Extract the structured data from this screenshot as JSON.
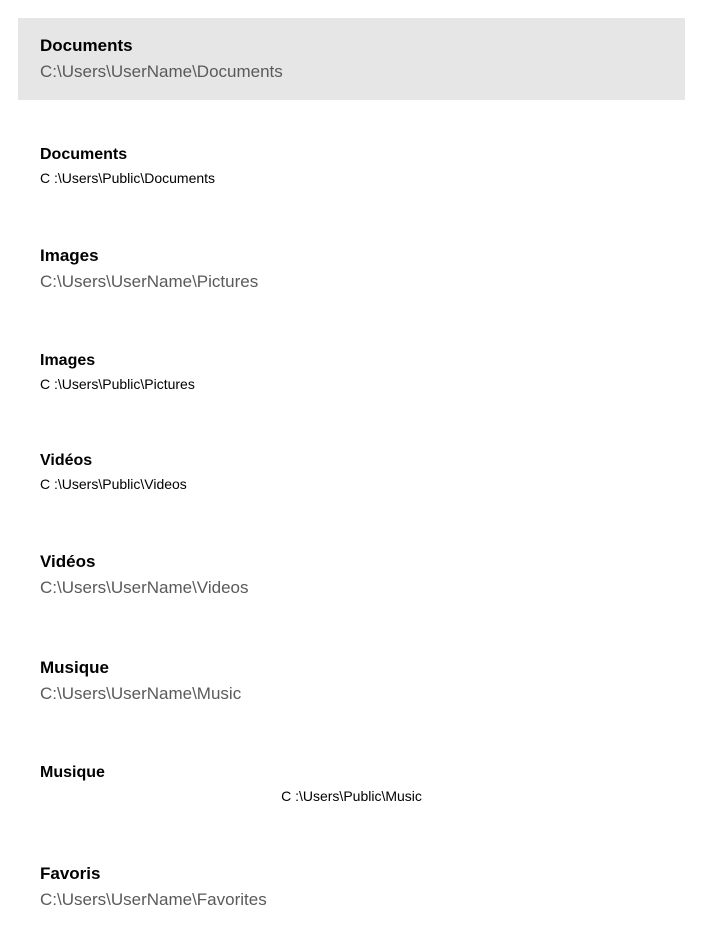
{
  "folders": [
    {
      "title": "Documents",
      "path": "C:\\Users\\UserName\\Documents",
      "selected": true,
      "secondary": false,
      "centeredPath": false
    },
    {
      "title": "Documents",
      "path": "C :\\Users\\Public\\Documents",
      "selected": false,
      "secondary": true,
      "centeredPath": false
    },
    {
      "title": "Images",
      "path": "C:\\Users\\UserName\\Pictures",
      "selected": false,
      "secondary": false,
      "centeredPath": false
    },
    {
      "title": "Images",
      "path": "C :\\Users\\Public\\Pictures",
      "selected": false,
      "secondary": true,
      "centeredPath": false
    },
    {
      "title": "Vidéos",
      "path": "C :\\Users\\Public\\Videos",
      "selected": false,
      "secondary": true,
      "centeredPath": false
    },
    {
      "title": "Vidéos",
      "path": "C:\\Users\\UserName\\Videos",
      "selected": false,
      "secondary": false,
      "centeredPath": false
    },
    {
      "title": "Musique",
      "path": "C:\\Users\\UserName\\Music",
      "selected": false,
      "secondary": false,
      "centeredPath": false
    },
    {
      "title": "Musique",
      "path": "C :\\Users\\Public\\Music",
      "selected": false,
      "secondary": true,
      "centeredPath": true
    },
    {
      "title": "Favoris",
      "path": "C:\\Users\\UserName\\Favorites",
      "selected": false,
      "secondary": false,
      "centeredPath": false
    }
  ]
}
